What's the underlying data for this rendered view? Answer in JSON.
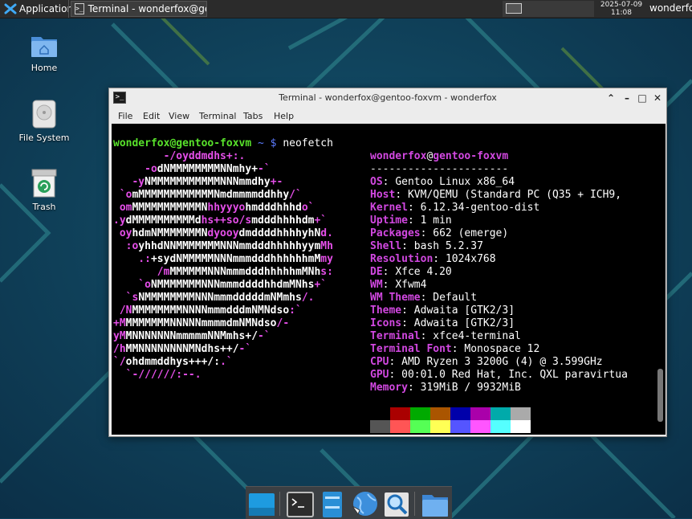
{
  "top_panel": {
    "applications_label": "Applications",
    "task_title": "Terminal - wonderfox@gen…",
    "clock_date": "2025-07-09",
    "clock_time": "11:08",
    "user_label": "wonderfox"
  },
  "desktop_icons": [
    {
      "label": "Home",
      "icon": "home-folder-icon"
    },
    {
      "label": "File System",
      "icon": "drive-icon"
    },
    {
      "label": "Trash",
      "icon": "trash-icon"
    }
  ],
  "window": {
    "title": "Terminal - wonderfox@gentoo-foxvm - wonderfox",
    "menu": [
      "File",
      "Edit",
      "View",
      "Terminal",
      "Tabs",
      "Help"
    ],
    "prompt": {
      "user_host": "wonderfox@gentoo-foxvm",
      "path": " ~ ",
      "symbol": "$",
      "command": " neofetch"
    },
    "logo_lines": [
      [
        {
          "t": "        -/oyddmdhs+:.",
          "c": "m"
        }
      ],
      [
        {
          "t": "     -o",
          "c": "m"
        },
        {
          "t": "dNMMMMMMMMNNmhy+",
          "c": "w"
        },
        {
          "t": "-`",
          "c": "m"
        }
      ],
      [
        {
          "t": "   -y",
          "c": "m"
        },
        {
          "t": "NMMMMMMMMMMMNNNmmdhy",
          "c": "w"
        },
        {
          "t": "+-",
          "c": "m"
        }
      ],
      [
        {
          "t": " `o",
          "c": "m"
        },
        {
          "t": "mMMMMMMMMMMMMNmdmmmmddhhy",
          "c": "w"
        },
        {
          "t": "/`",
          "c": "m"
        }
      ],
      [
        {
          "t": " om",
          "c": "m"
        },
        {
          "t": "MMMMMMMMMMMN",
          "c": "w"
        },
        {
          "t": "hhyyyo",
          "c": "m"
        },
        {
          "t": "hmdddhhhd",
          "c": "w"
        },
        {
          "t": "o`",
          "c": "m"
        }
      ],
      [
        {
          "t": ".y",
          "c": "m"
        },
        {
          "t": "dMMMMMMMMMMd",
          "c": "w"
        },
        {
          "t": "hs++so/s",
          "c": "m"
        },
        {
          "t": "mdddhhhhdm",
          "c": "w"
        },
        {
          "t": "+`",
          "c": "m"
        }
      ],
      [
        {
          "t": " oy",
          "c": "m"
        },
        {
          "t": "hdmNMMMMMMMN",
          "c": "w"
        },
        {
          "t": "dyooy",
          "c": "m"
        },
        {
          "t": "dmddddhhhhyhN",
          "c": "w"
        },
        {
          "t": "d.",
          "c": "m"
        }
      ],
      [
        {
          "t": "  :o",
          "c": "m"
        },
        {
          "t": "yhhdNNMMMMMMMNNNmmdddhhhhhyym",
          "c": "w"
        },
        {
          "t": "Mh",
          "c": "m"
        }
      ],
      [
        {
          "t": "    .:",
          "c": "m"
        },
        {
          "t": "+sydNMMMMMNNNmmmdddhhhhhhmM",
          "c": "w"
        },
        {
          "t": "my",
          "c": "m"
        }
      ],
      [
        {
          "t": "       /m",
          "c": "m"
        },
        {
          "t": "MMMMMMNNNmmmdddhhhhhmMNh",
          "c": "w"
        },
        {
          "t": "s:",
          "c": "m"
        }
      ],
      [
        {
          "t": "    `o",
          "c": "m"
        },
        {
          "t": "NMMMMMMMNNNmmmddddhhdmMNhs",
          "c": "w"
        },
        {
          "t": "+`",
          "c": "m"
        }
      ],
      [
        {
          "t": "  `s",
          "c": "m"
        },
        {
          "t": "NMMMMMMMMNNNmmmdddddmNMmhs",
          "c": "w"
        },
        {
          "t": "/.",
          "c": "m"
        }
      ],
      [
        {
          "t": " /N",
          "c": "m"
        },
        {
          "t": "MMMMMMMMNNNNmmmdddmNMNdso",
          "c": "w"
        },
        {
          "t": ":`",
          "c": "m"
        }
      ],
      [
        {
          "t": "+M",
          "c": "m"
        },
        {
          "t": "MMMMMMMNNNNNmmmmdmNMNdso",
          "c": "w"
        },
        {
          "t": "/-",
          "c": "m"
        }
      ],
      [
        {
          "t": "yM",
          "c": "m"
        },
        {
          "t": "MNNNNNNNmmmmmNNMmhs+/",
          "c": "w"
        },
        {
          "t": "-`",
          "c": "m"
        }
      ],
      [
        {
          "t": "/h",
          "c": "m"
        },
        {
          "t": "MMNNNNNNNNMNdhs++/",
          "c": "w"
        },
        {
          "t": "-`",
          "c": "m"
        }
      ],
      [
        {
          "t": "`/",
          "c": "m"
        },
        {
          "t": "ohdmmddhys+++/:",
          "c": "w"
        },
        {
          "t": ".`",
          "c": "m"
        }
      ],
      [
        {
          "t": "  `-//////:--.",
          "c": "m"
        }
      ]
    ],
    "info_header": {
      "user": "wonderfox",
      "at": "@",
      "host": "gentoo-foxvm",
      "underline": "----------------------"
    },
    "info": [
      {
        "key": "OS",
        "value": "Gentoo Linux x86_64"
      },
      {
        "key": "Host",
        "value": "KVM/QEMU (Standard PC (Q35 + ICH9,"
      },
      {
        "key": "Kernel",
        "value": "6.12.34-gentoo-dist"
      },
      {
        "key": "Uptime",
        "value": "1 min"
      },
      {
        "key": "Packages",
        "value": "662 (emerge)"
      },
      {
        "key": "Shell",
        "value": "bash 5.2.37"
      },
      {
        "key": "Resolution",
        "value": "1024x768"
      },
      {
        "key": "DE",
        "value": "Xfce 4.20"
      },
      {
        "key": "WM",
        "value": "Xfwm4"
      },
      {
        "key": "WM Theme",
        "value": "Default"
      },
      {
        "key": "Theme",
        "value": "Adwaita [GTK2/3]"
      },
      {
        "key": "Icons",
        "value": "Adwaita [GTK2/3]"
      },
      {
        "key": "Terminal",
        "value": "xfce4-terminal"
      },
      {
        "key": "Terminal Font",
        "value": "Monospace 12"
      },
      {
        "key": "CPU",
        "value": "AMD Ryzen 3 3200G (4) @ 3.599GHz"
      },
      {
        "key": "GPU",
        "value": "00:01.0 Red Hat, Inc. QXL paravirtua"
      },
      {
        "key": "Memory",
        "value": "319MiB / 9932MiB"
      }
    ],
    "palette_top": [
      "#000000",
      "#aa0000",
      "#00aa00",
      "#aa5500",
      "#0000aa",
      "#aa00aa",
      "#00aaaa",
      "#aaaaaa"
    ],
    "palette_bottom": [
      "#555555",
      "#ff5555",
      "#55ff55",
      "#ffff55",
      "#5555ff",
      "#ff55ff",
      "#55ffff",
      "#ffffff"
    ]
  },
  "dock": [
    "show-desktop-icon",
    "terminal-icon",
    "file-manager-icon",
    "web-browser-icon",
    "app-finder-icon",
    "folder-icon"
  ],
  "colors": {
    "accent_magenta": "#d248e1",
    "prompt_green": "#58e22b",
    "path_blue": "#5c7bff"
  }
}
